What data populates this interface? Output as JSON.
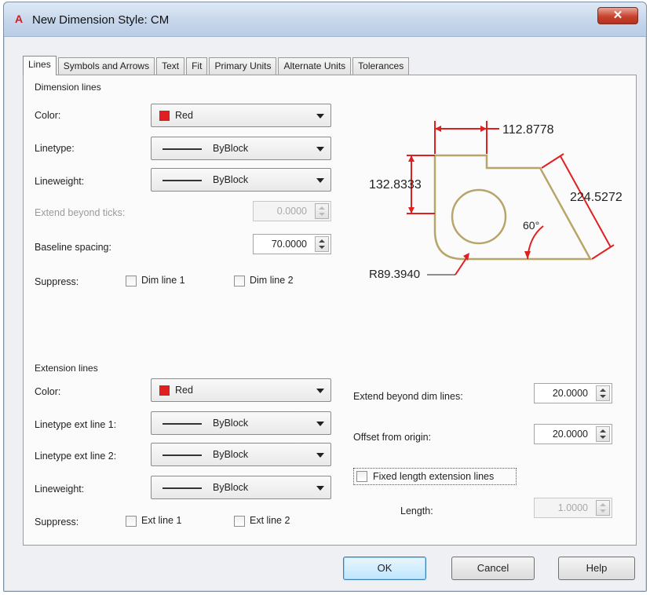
{
  "window": {
    "title": "New Dimension Style: CM",
    "close_glyph": "✕"
  },
  "tabs": [
    {
      "label": "Lines",
      "active": true
    },
    {
      "label": "Symbols and Arrows"
    },
    {
      "label": "Text"
    },
    {
      "label": "Fit"
    },
    {
      "label": "Primary Units"
    },
    {
      "label": "Alternate Units"
    },
    {
      "label": "Tolerances"
    }
  ],
  "dimension_lines": {
    "title": "Dimension lines",
    "color_label": "Color:",
    "color_value": "Red",
    "linetype_label": "Linetype:",
    "linetype_value": "ByBlock",
    "lineweight_label": "Lineweight:",
    "lineweight_value": "ByBlock",
    "extend_label": "Extend beyond ticks:",
    "extend_value": "0.0000",
    "baseline_label": "Baseline spacing:",
    "baseline_value": "70.0000",
    "suppress_label": "Suppress:",
    "dim_line_1": "Dim line 1",
    "dim_line_2": "Dim line 2"
  },
  "extension_lines": {
    "title": "Extension lines",
    "color_label": "Color:",
    "color_value": "Red",
    "linetype1_label": "Linetype ext line 1:",
    "linetype1_value": "ByBlock",
    "linetype2_label": "Linetype ext line 2:",
    "linetype2_value": "ByBlock",
    "lineweight_label": "Lineweight:",
    "lineweight_value": "ByBlock",
    "suppress_label": "Suppress:",
    "ext_line_1": "Ext line 1",
    "ext_line_2": "Ext line 2",
    "extend_dim_label": "Extend beyond dim lines:",
    "extend_dim_value": "20.0000",
    "offset_label": "Offset from origin:",
    "offset_value": "20.0000",
    "fixed_length_label": "Fixed length extension lines",
    "length_label": "Length:",
    "length_value": "1.0000"
  },
  "preview": {
    "dim_top": "112.8778",
    "dim_left": "132.8333",
    "dim_right": "224.5272",
    "angle": "60°",
    "radius": "R89.3940"
  },
  "buttons": {
    "ok": "OK",
    "cancel": "Cancel",
    "help": "Help"
  },
  "colors": {
    "accent_red": "#e02020",
    "preview_shape": "#b8a56a",
    "preview_dim": "#e02020"
  }
}
